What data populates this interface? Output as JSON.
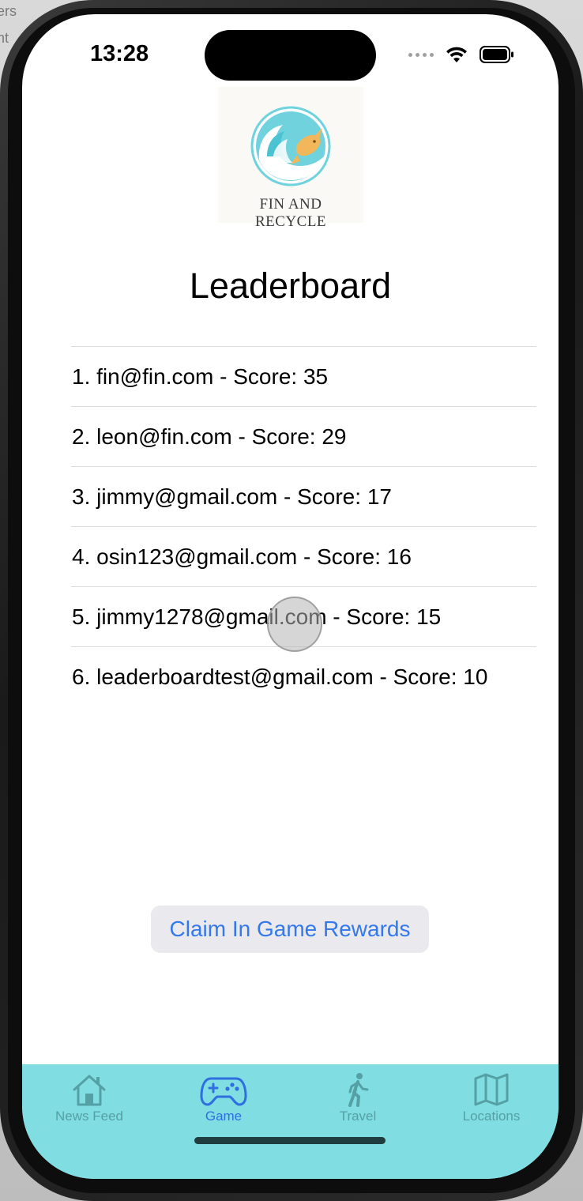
{
  "status_bar": {
    "time": "13:28"
  },
  "logo": {
    "line1": "FIN AND",
    "line2": "RECYCLE"
  },
  "page": {
    "title": "Leaderboard"
  },
  "leaderboard": [
    {
      "text": "1. fin@fin.com - Score: 35"
    },
    {
      "text": "2. leon@fin.com - Score: 29"
    },
    {
      "text": "3. jimmy@gmail.com - Score: 17"
    },
    {
      "text": "4. osin123@gmail.com - Score: 16"
    },
    {
      "text": "5. jimmy1278@gmail.com - Score: 15"
    },
    {
      "text": "6. leaderboardtest@gmail.com - Score: 10"
    }
  ],
  "actions": {
    "claim_label": "Claim In Game Rewards"
  },
  "tabbar": {
    "tabs": [
      {
        "label": "News Feed",
        "icon": "house-icon",
        "active": false
      },
      {
        "label": "Game",
        "icon": "gamecontroller-icon",
        "active": true
      },
      {
        "label": "Travel",
        "icon": "walking-figure-icon",
        "active": false
      },
      {
        "label": "Locations",
        "icon": "map-icon",
        "active": false
      }
    ]
  },
  "background": {
    "left_text_1": "ers",
    "left_text_2": "nt"
  },
  "colors": {
    "accent": "#3479ec",
    "tabbar_bg": "#80dde2",
    "inactive_tab": "#55a0a5"
  }
}
